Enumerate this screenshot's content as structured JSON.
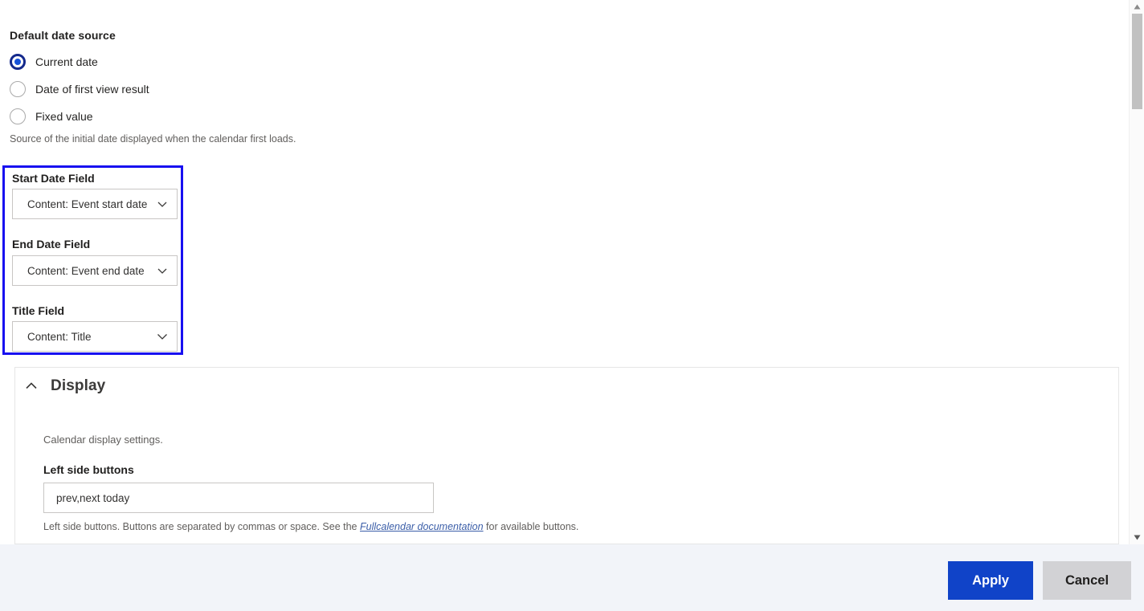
{
  "date_source": {
    "heading": "Default date source",
    "options": [
      {
        "label": "Current date",
        "selected": true
      },
      {
        "label": "Date of first view result",
        "selected": false
      },
      {
        "label": "Fixed value",
        "selected": false
      }
    ],
    "hint": "Source of the initial date displayed when the calendar first loads."
  },
  "field_group": {
    "highlight_color": "#1810f0",
    "fields": [
      {
        "label": "Start Date Field",
        "value": "Content: Event start date"
      },
      {
        "label": "End Date Field",
        "value": "Content: Event end date"
      },
      {
        "label": "Title Field",
        "value": "Content: Title"
      }
    ]
  },
  "display_section": {
    "title": "Display",
    "collapse_icon": "chevron-up-icon",
    "description": "Calendar display settings.",
    "left_side_buttons": {
      "label": "Left side buttons",
      "value": "prev,next today",
      "placeholder": "",
      "hint_before": "Left side buttons. Buttons are separated by commas or space. See the ",
      "hint_link": "Fullcalendar documentation",
      "hint_after": " for available buttons."
    }
  },
  "footer": {
    "apply_label": "Apply",
    "cancel_label": "Cancel",
    "apply_color": "#1043c8",
    "cancel_color": "#d2d2d5",
    "background": "#f2f4f9"
  },
  "scrollbar": {
    "up_icon": "scroll-up-arrow-icon",
    "down_icon": "scroll-down-arrow-icon"
  }
}
